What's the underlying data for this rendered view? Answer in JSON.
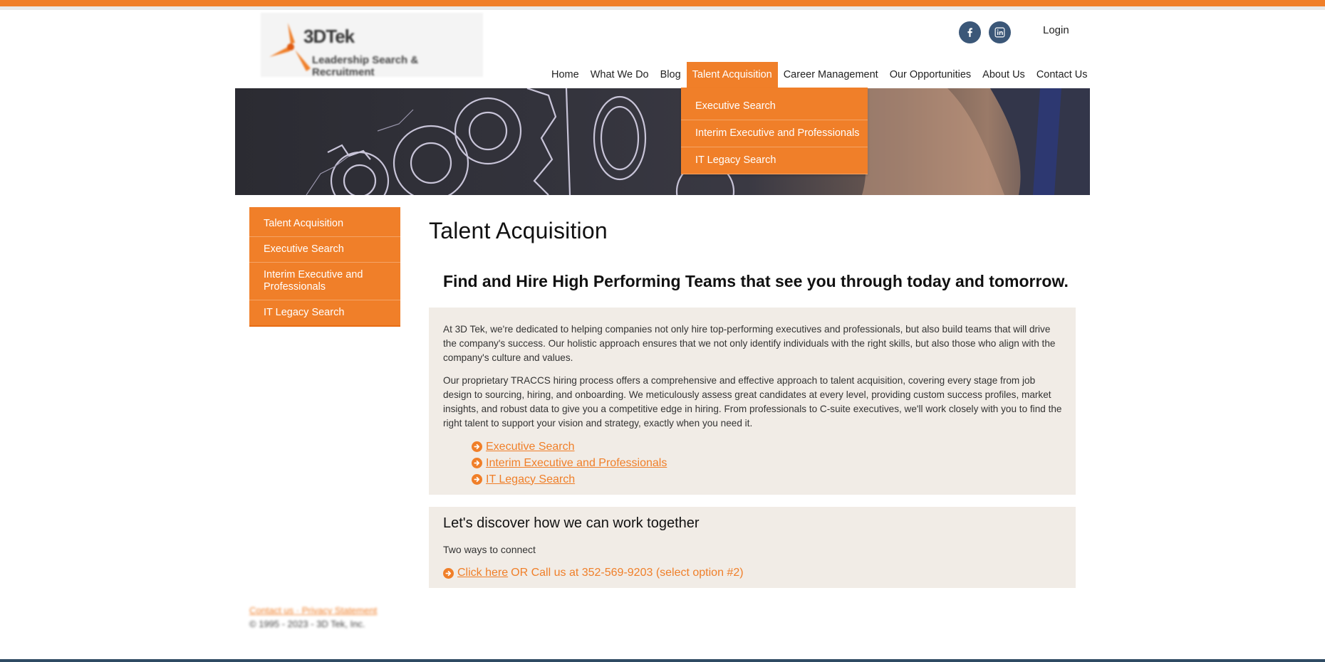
{
  "brand": {
    "logo_name": "3DTek",
    "logo_tagline": "Leadership Search & Recruitment",
    "accent_color": "#f07f29"
  },
  "header": {
    "social": [
      {
        "name": "facebook",
        "icon": "facebook-icon"
      },
      {
        "name": "linkedin",
        "icon": "linkedin-icon"
      }
    ],
    "login_label": "Login"
  },
  "nav": {
    "items": [
      {
        "label": "Home",
        "active": false
      },
      {
        "label": "What We Do",
        "active": false
      },
      {
        "label": "Blog",
        "active": false
      },
      {
        "label": "Talent Acquisition",
        "active": true
      },
      {
        "label": "Career Management",
        "active": false
      },
      {
        "label": "Our Opportunities",
        "active": false
      },
      {
        "label": "About Us",
        "active": false
      },
      {
        "label": "Contact Us",
        "active": false
      }
    ],
    "dropdown": [
      {
        "label": "Executive Search"
      },
      {
        "label": "Interim Executive and Professionals"
      },
      {
        "label": "IT Legacy Search"
      }
    ]
  },
  "sidebar": {
    "items": [
      {
        "label": "Talent Acquisition"
      },
      {
        "label": "Executive Search"
      },
      {
        "label": "Interim Executive and Professionals"
      },
      {
        "label": "IT Legacy Search"
      }
    ]
  },
  "main": {
    "title": "Talent Acquisition",
    "tagline": "Find and Hire High Performing Teams that see you through today and tomorrow.",
    "paragraph1": "At 3D Tek, we're dedicated to helping companies not only hire top-performing executives and professionals, but also build teams that will drive the company's success. Our holistic approach ensures that we not only identify individuals with the right skills, but also those who align with the company's culture and values.",
    "paragraph2": "Our proprietary TRACCS hiring process offers a comprehensive and effective approach to talent acquisition, covering every stage from job design to sourcing, hiring, and onboarding. We meticulously assess great candidates at every level, providing custom success profiles, market insights, and robust data to give you a competitive edge in hiring. From professionals to C-suite executives, we'll work closely with you to find the right talent to support your vision and strategy, exactly when you need it.",
    "links": [
      {
        "label": "Executive Search"
      },
      {
        "label": "Interim Executive and Professionals"
      },
      {
        "label": "IT Legacy Search"
      }
    ]
  },
  "cta": {
    "heading": "Let's discover how we can work together",
    "subheading": "Two ways to connect",
    "link_label": "Click here",
    "rest_text": "OR Call us at 352-569-9203 (select option #2)"
  },
  "footer": {
    "links": "Contact us · Privacy Statement",
    "copyright": "© 1995 - 2023 - 3D Tek, Inc."
  }
}
